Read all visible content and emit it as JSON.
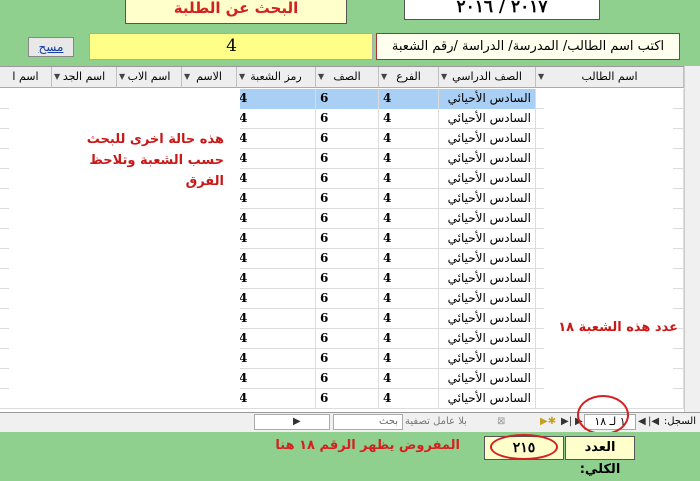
{
  "header": {
    "title": "البحث عن الطلبة",
    "year": "٢٠١٧ / ٢٠١٦"
  },
  "search": {
    "clear_label": "مسح",
    "value": "4",
    "label": "اكتب اسم الطالب/ المدرسة/ الدراسة /رقم الشعبة"
  },
  "columns": [
    "اسم الطالب",
    "الصف الدراسي",
    "الفرع",
    "الصف",
    "رمز الشعبة",
    "الاسم",
    "اسم الاب",
    "اسم الجد",
    "اسم ا"
  ],
  "rows": [
    {
      "stage": "السادس الأحيائي",
      "branch": "4",
      "grade": "6",
      "code": "4"
    },
    {
      "stage": "السادس الأحيائي",
      "branch": "4",
      "grade": "6",
      "code": "4"
    },
    {
      "stage": "السادس الأحيائي",
      "branch": "4",
      "grade": "6",
      "code": "4"
    },
    {
      "stage": "السادس الأحيائي",
      "branch": "4",
      "grade": "6",
      "code": "4"
    },
    {
      "stage": "السادس الأحيائي",
      "branch": "4",
      "grade": "6",
      "code": "4"
    },
    {
      "stage": "السادس الأحيائي",
      "branch": "4",
      "grade": "6",
      "code": "4"
    },
    {
      "stage": "السادس الأحيائي",
      "branch": "4",
      "grade": "6",
      "code": "4"
    },
    {
      "stage": "السادس الأحيائي",
      "branch": "4",
      "grade": "6",
      "code": "4"
    },
    {
      "stage": "السادس الأحيائي",
      "branch": "4",
      "grade": "6",
      "code": "4"
    },
    {
      "stage": "السادس الأحيائي",
      "branch": "4",
      "grade": "6",
      "code": "4"
    },
    {
      "stage": "السادس الأحيائي",
      "branch": "4",
      "grade": "6",
      "code": "4"
    },
    {
      "stage": "السادس الأحيائي",
      "branch": "4",
      "grade": "6",
      "code": "4"
    },
    {
      "stage": "السادس الأحيائي",
      "branch": "4",
      "grade": "6",
      "code": "4"
    },
    {
      "stage": "السادس الأحيائي",
      "branch": "4",
      "grade": "6",
      "code": "4"
    },
    {
      "stage": "السادس الأحيائي",
      "branch": "4",
      "grade": "6",
      "code": "4"
    },
    {
      "stage": "السادس الأحيائي",
      "branch": "4",
      "grade": "6",
      "code": "4"
    }
  ],
  "annotations": {
    "note": "هذه حالة اخرى للبحث حسب الشعبة وتلاحظ الفرق",
    "count_note": "عدد هذه الشعبة ١٨",
    "expected_note": "المفروض يظهر الرقم ١٨ هنا"
  },
  "nav": {
    "record_label": "السجل:",
    "record_value": "١ لـ ١٨",
    "filter_label": "بلا عامل تصفية",
    "search_placeholder": "بحث"
  },
  "footer": {
    "total_label": "العدد الكلي:",
    "total_value": "٢١٥"
  },
  "colors": {
    "background": "#8fd08f",
    "annotation_red": "#d42020",
    "selected_row": "#a9cff5"
  }
}
